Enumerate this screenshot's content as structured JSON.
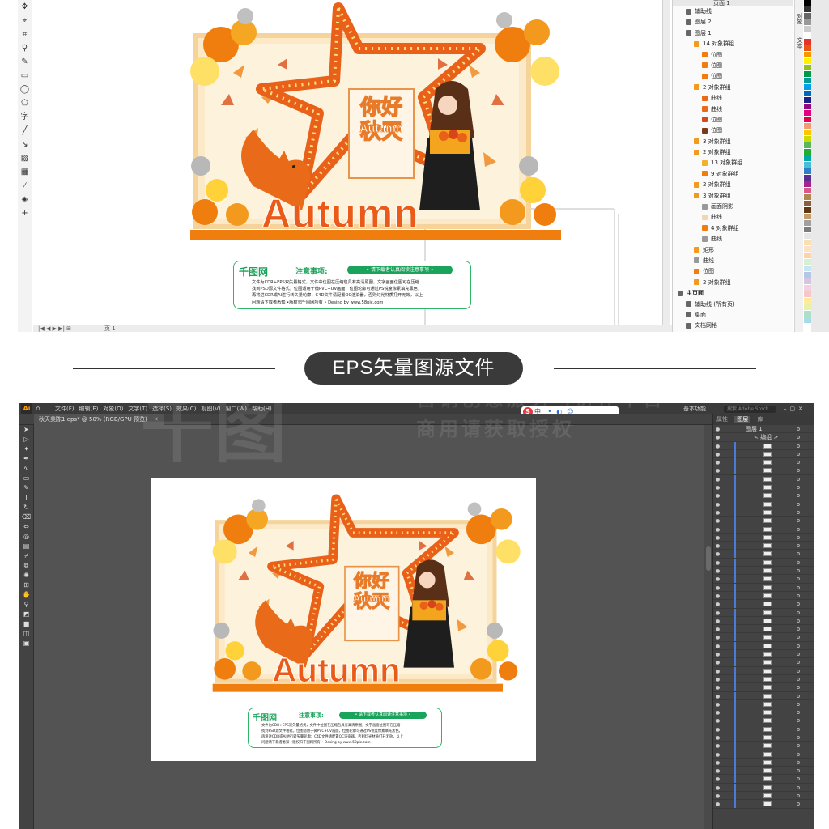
{
  "top_app": {
    "status_tab": "页 1",
    "objects_header": "页面 1",
    "objects": [
      {
        "label": "辅助线",
        "indent": 1,
        "color": "#666666"
      },
      {
        "label": "图层 2",
        "indent": 1,
        "color": "#666666"
      },
      {
        "label": "图层 1",
        "indent": 1,
        "color": "#666666"
      },
      {
        "label": "14 对象群组",
        "indent": 2,
        "color": "#f39a1e"
      },
      {
        "label": "位图",
        "indent": 3,
        "color": "#f07e0f"
      },
      {
        "label": "位图",
        "indent": 3,
        "color": "#f07e0f"
      },
      {
        "label": "位图",
        "indent": 3,
        "color": "#f07e0f"
      },
      {
        "label": "2 对象群组",
        "indent": 2,
        "color": "#f39a1e"
      },
      {
        "label": "曲线",
        "indent": 3,
        "color": "#e96b1a"
      },
      {
        "label": "曲线",
        "indent": 3,
        "color": "#e96b1a"
      },
      {
        "label": "位图",
        "indent": 3,
        "color": "#d24b1b"
      },
      {
        "label": "位图",
        "indent": 3,
        "color": "#7a3b1a"
      },
      {
        "label": "3 对象群组",
        "indent": 2,
        "color": "#f39a1e"
      },
      {
        "label": "2 对象群组",
        "indent": 2,
        "color": "#f39a1e"
      },
      {
        "label": "13 对象群组",
        "indent": 3,
        "color": "#f0b22a"
      },
      {
        "label": "9 对象群组",
        "indent": 3,
        "color": "#f07e0f"
      },
      {
        "label": "2 对象群组",
        "indent": 2,
        "color": "#f39a1e"
      },
      {
        "label": "3 对象群组",
        "indent": 2,
        "color": "#f39a1e"
      },
      {
        "label": "画面阴影",
        "indent": 3,
        "color": "#999999"
      },
      {
        "label": "曲线",
        "indent": 3,
        "color": "#f3d6b0"
      },
      {
        "label": "4 对象群组",
        "indent": 3,
        "color": "#f07e0f"
      },
      {
        "label": "曲线",
        "indent": 3,
        "color": "#999999"
      },
      {
        "label": "矩形",
        "indent": 2,
        "color": "#f39a1e"
      },
      {
        "label": "曲线",
        "indent": 2,
        "color": "#999999"
      },
      {
        "label": "位图",
        "indent": 2,
        "color": "#f07e0f"
      },
      {
        "label": "2 对象群组",
        "indent": 2,
        "color": "#f39a1e"
      },
      {
        "label": "主页面",
        "indent": 0,
        "color": "#666666"
      },
      {
        "label": "辅助线 (所有页)",
        "indent": 1,
        "color": "#666666"
      },
      {
        "label": "桌面",
        "indent": 1,
        "color": "#666666"
      },
      {
        "label": "文档网格",
        "indent": 1,
        "color": "#666666"
      }
    ],
    "dock_labels": [
      "对象",
      "文本"
    ],
    "palette": [
      "#000000",
      "#333333",
      "#666666",
      "#999999",
      "#cccccc",
      "#ffffff",
      "#e5332a",
      "#ea5514",
      "#f39800",
      "#fff100",
      "#8fc31f",
      "#009944",
      "#009e96",
      "#00a0e9",
      "#0068b7",
      "#1d2088",
      "#920783",
      "#e4007f",
      "#e5004f",
      "#f29b76",
      "#fcc800",
      "#cfdb00",
      "#5bb65d",
      "#22ac38",
      "#00a7a9",
      "#4cbdd8",
      "#2e81c6",
      "#5c2d91",
      "#a5248f",
      "#d85a8d",
      "#b28850",
      "#8b5e3c",
      "#603813",
      "#c69c6d",
      "#a0a0a0",
      "#7d7d7d",
      "#e6e6e6",
      "#f7e0b5",
      "#fce2c4",
      "#ffd3a8",
      "#d8f0d2",
      "#c8e6ef",
      "#b5c6e6",
      "#d6c5e0",
      "#f3cfe0",
      "#f7c6c6",
      "#ffe99a",
      "#e9f1a8",
      "#aee0c8",
      "#a7dbe6"
    ]
  },
  "banner": {
    "label": "EPS矢量图源文件"
  },
  "artwork": {
    "heading_cn": "你好秋天",
    "heading_en": "Autumn",
    "big_word": "Autumn",
    "notice_brand": "千图网",
    "notice_title": "注意事项:",
    "notice_pill": "• 请下载者认真阅读注意事项 •",
    "notice_body_1": "文件为CDR+EPS双矢量格式，文件中位图在压缩包具有高清原图，文字画面位图可在压缩",
    "notice_body_2": "找到PSD源文件格式，位图适用于微PVC+UV画面，位图轮廓可通过PS锐度像素填充黑色，",
    "notice_body_3": "再将进CDR或AI进行转矢量轮廓；C4D文件请配置OC渲染器，否则灯光材质打开无效，以上",
    "notice_body_4": "问题请下载者悉知 •版权归千图网所有 • Desing by www.58pic.com"
  },
  "bottom_app": {
    "logo": "Ai",
    "menus": [
      "文件(F)",
      "编辑(E)",
      "对象(O)",
      "文字(T)",
      "选择(S)",
      "效果(C)",
      "视图(V)",
      "窗口(W)",
      "帮助(H)"
    ],
    "workspace": "基本功能",
    "search_placeholder": "搜索 Adobe Stock",
    "doc_tab": "秋天美陈1.eps* @ 50% (RGB/GPU 预览)",
    "panel_tabs": [
      "属性",
      "图层",
      "库"
    ],
    "layer_name": "图层 1",
    "group_name": "< 编组 >",
    "ime_label": "中",
    "watermark_1": "营销创意服务与协作平台",
    "watermark_2": "商用请获取授权",
    "watermark_logo": "千图"
  }
}
